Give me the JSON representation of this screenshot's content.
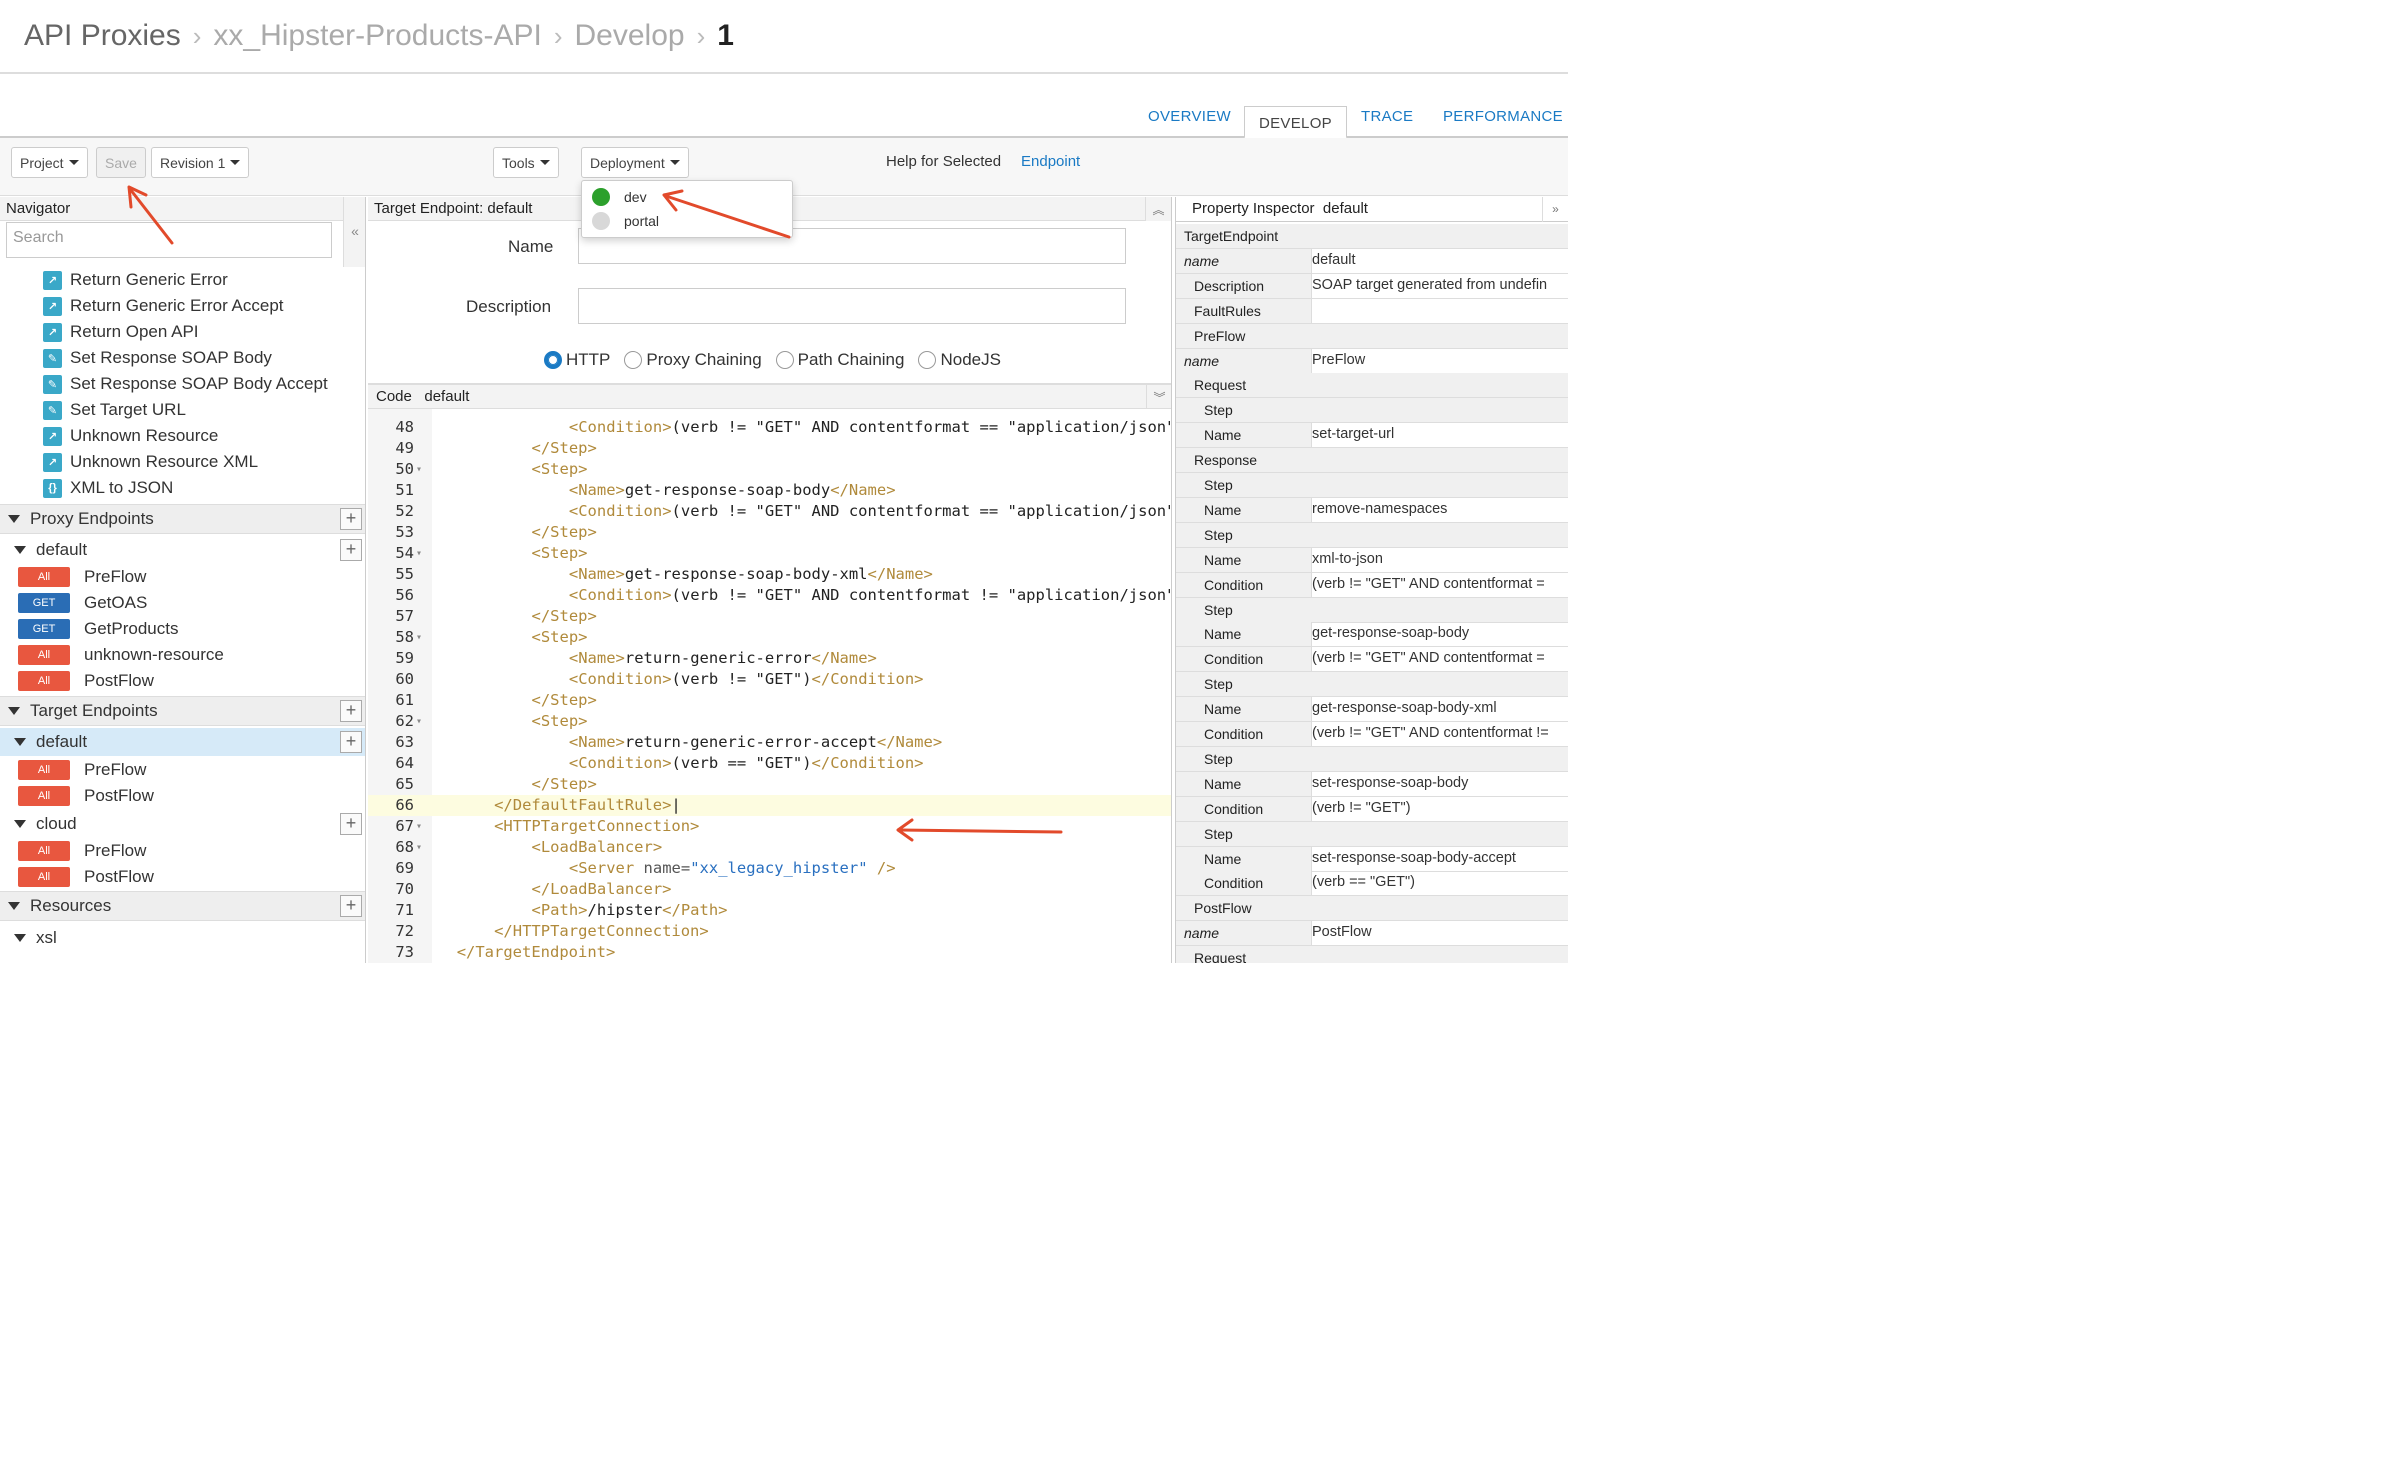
{
  "breadcrumb": {
    "items": [
      "API Proxies",
      "xx_Hipster-Products-API",
      "Develop"
    ],
    "current": "1"
  },
  "tabs": [
    "OVERVIEW",
    "DEVELOP",
    "TRACE",
    "PERFORMANCE"
  ],
  "toolbar": {
    "project": "Project",
    "save": "Save",
    "revision": "Revision 1",
    "tools": "Tools",
    "deployment": "Deployment",
    "help_label": "Help for Selected",
    "help_link": "Endpoint"
  },
  "deployment_menu": [
    {
      "label": "dev",
      "color": "#2ca02c"
    },
    {
      "label": "portal",
      "color": "#d8d8d8"
    }
  ],
  "navigator": {
    "title": "Navigator",
    "search_placeholder": "Search",
    "policies": [
      {
        "label": "Return Generic Error",
        "icon": "raise-fault-icon",
        "color": "#3aa8c8"
      },
      {
        "label": "Return Generic Error Accept",
        "icon": "raise-fault-icon",
        "color": "#3aa8c8"
      },
      {
        "label": "Return Open API",
        "icon": "raise-fault-icon",
        "color": "#3aa8c8"
      },
      {
        "label": "Set Response SOAP Body",
        "icon": "assign-message-icon",
        "color": "#3aa8c8"
      },
      {
        "label": "Set Response SOAP Body Accept",
        "icon": "assign-message-icon",
        "color": "#3aa8c8"
      },
      {
        "label": "Set Target URL",
        "icon": "assign-message-icon",
        "color": "#3aa8c8"
      },
      {
        "label": "Unknown Resource",
        "icon": "raise-fault-icon",
        "color": "#3aa8c8"
      },
      {
        "label": "Unknown Resource XML",
        "icon": "raise-fault-icon",
        "color": "#3aa8c8"
      },
      {
        "label": "XML to JSON",
        "icon": "xml-to-json-icon",
        "color": "#3aa8c8"
      }
    ],
    "proxy_endpoints": {
      "label": "Proxy Endpoints",
      "default": {
        "label": "default",
        "flows": [
          {
            "method": "All",
            "label": "PreFlow"
          },
          {
            "method": "GET",
            "label": "GetOAS"
          },
          {
            "method": "GET",
            "label": "GetProducts"
          },
          {
            "method": "All",
            "label": "unknown-resource"
          },
          {
            "method": "All",
            "label": "PostFlow"
          }
        ]
      }
    },
    "target_endpoints": {
      "label": "Target Endpoints",
      "default": {
        "label": "default",
        "flows": [
          {
            "method": "All",
            "label": "PreFlow"
          },
          {
            "method": "All",
            "label": "PostFlow"
          }
        ]
      },
      "cloud": {
        "label": "cloud",
        "flows": [
          {
            "method": "All",
            "label": "PreFlow"
          },
          {
            "method": "All",
            "label": "PostFlow"
          }
        ]
      }
    },
    "resources": {
      "label": "Resources",
      "xsl": "xsl"
    }
  },
  "editor": {
    "title": "Target Endpoint: default",
    "name_label": "Name",
    "description_label": "Description",
    "radios": [
      {
        "label": "HTTP",
        "checked": true
      },
      {
        "label": "Proxy Chaining",
        "checked": false
      },
      {
        "label": "Path Chaining",
        "checked": false
      },
      {
        "label": "NodeJS",
        "checked": false
      }
    ],
    "code_title": "Code",
    "code_name": "default",
    "code_lines": [
      {
        "n": "48",
        "fold": false,
        "indent": 14,
        "parts": [
          [
            "tg",
            "<Condition>"
          ],
          [
            "tx",
            "(verb != \"GET\" AND contentformat == \"application/json\")"
          ]
        ]
      },
      {
        "n": "49",
        "fold": false,
        "indent": 10,
        "parts": [
          [
            "tg",
            "</Step>"
          ]
        ]
      },
      {
        "n": "50",
        "fold": true,
        "indent": 10,
        "parts": [
          [
            "tg",
            "<Step>"
          ]
        ]
      },
      {
        "n": "51",
        "fold": false,
        "indent": 14,
        "parts": [
          [
            "tg",
            "<Name>"
          ],
          [
            "tx",
            "get-response-soap-body"
          ],
          [
            "tg",
            "</Name>"
          ]
        ]
      },
      {
        "n": "52",
        "fold": false,
        "indent": 14,
        "parts": [
          [
            "tg",
            "<Condition>"
          ],
          [
            "tx",
            "(verb != \"GET\" AND contentformat == \"application/json\")"
          ]
        ]
      },
      {
        "n": "53",
        "fold": false,
        "indent": 10,
        "parts": [
          [
            "tg",
            "</Step>"
          ]
        ]
      },
      {
        "n": "54",
        "fold": true,
        "indent": 10,
        "parts": [
          [
            "tg",
            "<Step>"
          ]
        ]
      },
      {
        "n": "55",
        "fold": false,
        "indent": 14,
        "parts": [
          [
            "tg",
            "<Name>"
          ],
          [
            "tx",
            "get-response-soap-body-xml"
          ],
          [
            "tg",
            "</Name>"
          ]
        ]
      },
      {
        "n": "56",
        "fold": false,
        "indent": 14,
        "parts": [
          [
            "tg",
            "<Condition>"
          ],
          [
            "tx",
            "(verb != \"GET\" AND contentformat != \"application/json\")"
          ]
        ]
      },
      {
        "n": "57",
        "fold": false,
        "indent": 10,
        "parts": [
          [
            "tg",
            "</Step>"
          ]
        ]
      },
      {
        "n": "58",
        "fold": true,
        "indent": 10,
        "parts": [
          [
            "tg",
            "<Step>"
          ]
        ]
      },
      {
        "n": "59",
        "fold": false,
        "indent": 14,
        "parts": [
          [
            "tg",
            "<Name>"
          ],
          [
            "tx",
            "return-generic-error"
          ],
          [
            "tg",
            "</Name>"
          ]
        ]
      },
      {
        "n": "60",
        "fold": false,
        "indent": 14,
        "parts": [
          [
            "tg",
            "<Condition>"
          ],
          [
            "tx",
            "(verb != \"GET\")"
          ],
          [
            "tg",
            "</Condition>"
          ]
        ]
      },
      {
        "n": "61",
        "fold": false,
        "indent": 10,
        "parts": [
          [
            "tg",
            "</Step>"
          ]
        ]
      },
      {
        "n": "62",
        "fold": true,
        "indent": 10,
        "parts": [
          [
            "tg",
            "<Step>"
          ]
        ]
      },
      {
        "n": "63",
        "fold": false,
        "indent": 14,
        "parts": [
          [
            "tg",
            "<Name>"
          ],
          [
            "tx",
            "return-generic-error-accept"
          ],
          [
            "tg",
            "</Name>"
          ]
        ]
      },
      {
        "n": "64",
        "fold": false,
        "indent": 14,
        "parts": [
          [
            "tg",
            "<Condition>"
          ],
          [
            "tx",
            "(verb == \"GET\")"
          ],
          [
            "tg",
            "</Condition>"
          ]
        ]
      },
      {
        "n": "65",
        "fold": false,
        "indent": 10,
        "parts": [
          [
            "tg",
            "</Step>"
          ]
        ]
      },
      {
        "n": "66",
        "fold": false,
        "indent": 6,
        "hl": true,
        "parts": [
          [
            "tg",
            "</DefaultFaultRule>"
          ],
          [
            "tx",
            "|"
          ]
        ]
      },
      {
        "n": "67",
        "fold": true,
        "indent": 6,
        "parts": [
          [
            "tg",
            "<HTTPTargetConnection>"
          ]
        ]
      },
      {
        "n": "68",
        "fold": true,
        "indent": 10,
        "parts": [
          [
            "tg",
            "<LoadBalancer>"
          ]
        ]
      },
      {
        "n": "69",
        "fold": false,
        "indent": 14,
        "parts": [
          [
            "tg",
            "<Server "
          ],
          [
            "at",
            "name="
          ],
          [
            "av",
            "\"xx_legacy_hipster\""
          ],
          [
            "tg",
            " />"
          ]
        ]
      },
      {
        "n": "70",
        "fold": false,
        "indent": 10,
        "parts": [
          [
            "tg",
            "</LoadBalancer>"
          ]
        ]
      },
      {
        "n": "71",
        "fold": false,
        "indent": 10,
        "parts": [
          [
            "tg",
            "<Path>"
          ],
          [
            "tx",
            "/hipster"
          ],
          [
            "tg",
            "</Path>"
          ]
        ]
      },
      {
        "n": "72",
        "fold": false,
        "indent": 6,
        "parts": [
          [
            "tg",
            "</HTTPTargetConnection>"
          ]
        ]
      },
      {
        "n": "73",
        "fold": false,
        "indent": 2,
        "parts": [
          [
            "tg",
            "</TargetEndpoint>"
          ]
        ]
      }
    ]
  },
  "inspector": {
    "title": "Property Inspector",
    "name": "default",
    "rows": [
      {
        "k": "TargetEndpoint",
        "v": null,
        "style": "sec"
      },
      {
        "k": "name",
        "v": "default",
        "style": "i"
      },
      {
        "k": "Description",
        "v": "SOAP target generated from undefin",
        "style": "ind1"
      },
      {
        "k": "FaultRules",
        "v": "",
        "style": "ind1"
      },
      {
        "k": "PreFlow",
        "v": null,
        "style": "ind1sec"
      },
      {
        "k": "name",
        "v": "PreFlow",
        "style": "i"
      },
      {
        "k": "Request",
        "v": null,
        "style": "ind1sec"
      },
      {
        "k": "Step",
        "v": null,
        "style": "ind2sec"
      },
      {
        "k": "Name",
        "v": "set-target-url",
        "style": "ind2"
      },
      {
        "k": "Response",
        "v": null,
        "style": "ind1sec"
      },
      {
        "k": "Step",
        "v": null,
        "style": "ind2sec"
      },
      {
        "k": "Name",
        "v": "remove-namespaces",
        "style": "ind2"
      },
      {
        "k": "Step",
        "v": null,
        "style": "ind2sec"
      },
      {
        "k": "Name",
        "v": "xml-to-json",
        "style": "ind2"
      },
      {
        "k": "Condition",
        "v": "(verb != \"GET\" AND contentformat =",
        "style": "ind2"
      },
      {
        "k": "Step",
        "v": null,
        "style": "ind2sec"
      },
      {
        "k": "Name",
        "v": "get-response-soap-body",
        "style": "ind2"
      },
      {
        "k": "Condition",
        "v": "(verb != \"GET\" AND contentformat =",
        "style": "ind2"
      },
      {
        "k": "Step",
        "v": null,
        "style": "ind2sec"
      },
      {
        "k": "Name",
        "v": "get-response-soap-body-xml",
        "style": "ind2"
      },
      {
        "k": "Condition",
        "v": "(verb != \"GET\" AND contentformat !=",
        "style": "ind2"
      },
      {
        "k": "Step",
        "v": null,
        "style": "ind2sec"
      },
      {
        "k": "Name",
        "v": "set-response-soap-body",
        "style": "ind2"
      },
      {
        "k": "Condition",
        "v": "(verb != \"GET\")",
        "style": "ind2"
      },
      {
        "k": "Step",
        "v": null,
        "style": "ind2sec"
      },
      {
        "k": "Name",
        "v": "set-response-soap-body-accept",
        "style": "ind2"
      },
      {
        "k": "Condition",
        "v": "(verb == \"GET\")",
        "style": "ind2"
      },
      {
        "k": "PostFlow",
        "v": null,
        "style": "ind1sec"
      },
      {
        "k": "name",
        "v": "PostFlow",
        "style": "i"
      },
      {
        "k": "Request",
        "v": null,
        "style": "ind1sec"
      }
    ]
  },
  "colors": {
    "accent": "#1a7ac4",
    "badge_all": "#e8573f",
    "badge_get": "#2a6db5",
    "arrow": "#e24a2b",
    "xml_tag": "#b08a3b",
    "xml_value": "#2a70c0"
  }
}
